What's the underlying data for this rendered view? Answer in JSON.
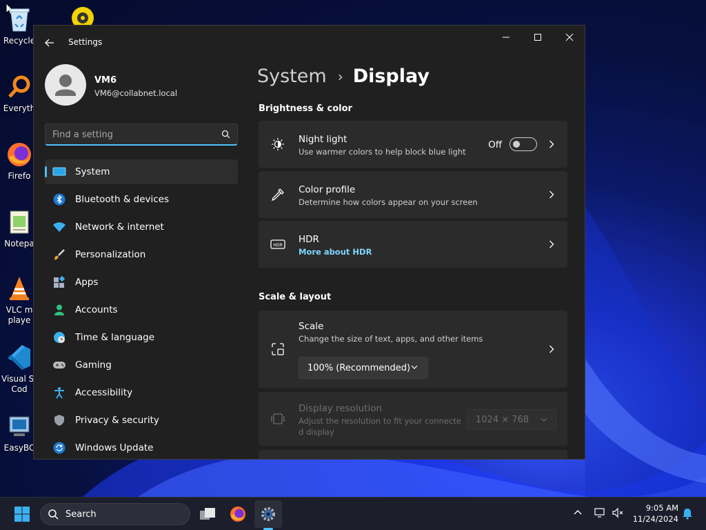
{
  "desktop": {
    "icons": [
      {
        "label": "Recycle",
        "icon": "recycle-bin-icon"
      },
      {
        "label": "",
        "icon": "disc-icon"
      },
      {
        "label": "Everyth",
        "icon": "everything-search-icon"
      },
      {
        "label": "Firefo",
        "icon": "firefox-icon"
      },
      {
        "label": "Notepa",
        "icon": "notepad-icon"
      },
      {
        "label": "VLC m",
        "label2": "playe",
        "icon": "vlc-icon"
      },
      {
        "label": "Visual St",
        "label2": "Cod",
        "icon": "vscode-icon"
      },
      {
        "label": "EasyBC",
        "icon": "easybcd-icon"
      }
    ]
  },
  "window": {
    "title": "Settings",
    "controls": [
      "minimize-icon",
      "maximize-icon",
      "close-icon"
    ]
  },
  "profile": {
    "name": "VM6",
    "email": "VM6@collabnet.local"
  },
  "search": {
    "placeholder": "Find a setting"
  },
  "nav": {
    "items": [
      {
        "label": "System",
        "icon": "system-display-icon",
        "active": true
      },
      {
        "label": "Bluetooth & devices",
        "icon": "bluetooth-icon"
      },
      {
        "label": "Network & internet",
        "icon": "wifi-icon"
      },
      {
        "label": "Personalization",
        "icon": "paintbrush-icon"
      },
      {
        "label": "Apps",
        "icon": "apps-icon"
      },
      {
        "label": "Accounts",
        "icon": "accounts-icon"
      },
      {
        "label": "Time & language",
        "icon": "globe-clock-icon"
      },
      {
        "label": "Gaming",
        "icon": "gamepad-icon"
      },
      {
        "label": "Accessibility",
        "icon": "accessibility-icon"
      },
      {
        "label": "Privacy & security",
        "icon": "shield-icon"
      },
      {
        "label": "Windows Update",
        "icon": "update-icon"
      }
    ]
  },
  "breadcrumb": {
    "parent": "System",
    "separator": "›",
    "current": "Display"
  },
  "sections": {
    "brightness": {
      "heading": "Brightness & color",
      "night_light": {
        "title": "Night light",
        "subtitle": "Use warmer colors to help block blue light",
        "state": "Off"
      },
      "color_profile": {
        "title": "Color profile",
        "subtitle": "Determine how colors appear on your screen"
      },
      "hdr": {
        "title": "HDR",
        "link": "More about HDR"
      }
    },
    "scale_layout": {
      "heading": "Scale & layout",
      "scale": {
        "title": "Scale",
        "subtitle": "Change the size of text, apps, and other items",
        "value": "100% (Recommended)"
      },
      "resolution": {
        "title": "Display resolution",
        "subtitle": "Adjust the resolution to fit your connecte",
        "subtitle2": "d display",
        "value": "1024 × 768"
      }
    }
  },
  "taskbar": {
    "search_label": "Search",
    "time": "9:05 AM",
    "date": "11/24/2024"
  },
  "colors": {
    "accent": "#4cc2ff",
    "window_bg": "#202020",
    "card_bg": "#2b2b2b"
  }
}
